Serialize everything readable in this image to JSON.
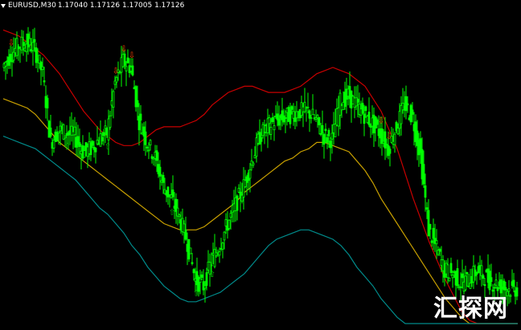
{
  "header": {
    "symbol_tf": "EURUSD,M30",
    "ohlc": "1.17040 1.17126 1.17005 1.17126"
  },
  "watermark": "汇探网",
  "colors": {
    "background": "#000000",
    "candle": "#00ff00",
    "band_upper": "#c80000",
    "band_mid": "#c8a000",
    "band_lower": "#008b8b",
    "arrow_down": "#ff4000",
    "arrow_up": "#00cc00"
  },
  "icons": {
    "dropdown": "triangle-down-icon",
    "sell_signal": "down-arrow-icon",
    "buy_signal": "up-arrow-icon"
  },
  "chart_data": {
    "type": "candlestick",
    "title": "EURUSD,M30",
    "xlabel": "",
    "ylabel": "",
    "grid": false,
    "ylim": [
      0,
      100
    ],
    "x": [
      0,
      1,
      2,
      3,
      4,
      5,
      6,
      7,
      8,
      9,
      10,
      11,
      12,
      13,
      14,
      15,
      16,
      17,
      18,
      19,
      20,
      21,
      22,
      23,
      24,
      25,
      26,
      27,
      28,
      29,
      30,
      31,
      32,
      33,
      34,
      35,
      36,
      37,
      38,
      39,
      40,
      41,
      42,
      43,
      44,
      45,
      46,
      47,
      48,
      49,
      50,
      51,
      52,
      53,
      54,
      55,
      56,
      57,
      58,
      59,
      60,
      61,
      62,
      63,
      64
    ],
    "close": [
      82,
      86,
      89,
      90,
      88,
      80,
      58,
      62,
      61,
      60,
      55,
      56,
      59,
      61,
      77,
      84,
      82,
      65,
      58,
      53,
      44,
      40,
      34,
      26,
      14,
      12,
      20,
      25,
      32,
      38,
      44,
      52,
      60,
      63,
      65,
      66,
      67,
      68,
      68,
      65,
      60,
      59,
      71,
      73,
      70,
      67,
      64,
      61,
      56,
      63,
      70,
      66,
      54,
      30,
      24,
      17,
      16,
      13,
      14,
      17,
      15,
      13,
      12,
      11,
      11
    ],
    "series": [
      {
        "values": [
          94,
          93,
          92,
          90,
          88,
          86,
          83,
          80,
          76,
          72,
          68,
          65,
          62,
          60,
          58,
          57,
          57,
          58,
          60,
          62,
          63,
          63,
          63,
          64,
          65,
          67,
          70,
          72,
          74,
          75,
          76,
          76,
          75,
          74,
          74,
          74,
          75,
          76,
          78,
          80,
          81,
          82,
          81,
          80,
          78,
          76,
          72,
          68,
          62,
          56,
          48,
          40,
          33,
          26,
          20,
          14,
          9,
          4,
          1,
          0,
          0,
          0,
          0,
          0,
          0
        ]
      },
      {
        "values": [
          72,
          71,
          70,
          69,
          67,
          64,
          61,
          58,
          56,
          54,
          52,
          50,
          48,
          46,
          44,
          42,
          40,
          38,
          36,
          34,
          32,
          31,
          30,
          30,
          30,
          31,
          33,
          35,
          37,
          39,
          42,
          44,
          46,
          48,
          50,
          52,
          53,
          55,
          56,
          58,
          58,
          57,
          56,
          55,
          52,
          49,
          45,
          40,
          36,
          32,
          28,
          24,
          20,
          16,
          12,
          8,
          5,
          2,
          0,
          0,
          0,
          0,
          0,
          0,
          0
        ]
      },
      {
        "values": [
          60,
          59,
          58,
          57,
          56,
          54,
          52,
          50,
          48,
          46,
          43,
          40,
          37,
          35,
          32,
          29,
          25,
          22,
          18,
          15,
          12,
          10,
          8,
          7,
          7,
          8,
          9,
          10,
          12,
          14,
          16,
          19,
          22,
          25,
          27,
          28,
          29,
          30,
          30,
          29,
          28,
          27,
          25,
          22,
          18,
          15,
          12,
          8,
          5,
          2,
          0,
          0,
          0,
          0,
          0,
          0,
          0,
          0,
          0,
          0,
          0,
          0,
          0,
          0,
          0
        ]
      }
    ],
    "signals": [
      {
        "type": "sell",
        "at": 1
      },
      {
        "type": "buy",
        "at": 8
      },
      {
        "type": "buy",
        "at": 13
      },
      {
        "type": "sell",
        "at": 15
      },
      {
        "type": "sell",
        "at": 16
      },
      {
        "type": "sell",
        "at": 14
      },
      {
        "type": "buy",
        "at": 21
      },
      {
        "type": "buy",
        "at": 24
      },
      {
        "type": "buy",
        "at": 26
      },
      {
        "type": "sell",
        "at": 48
      },
      {
        "type": "sell",
        "at": 47
      }
    ]
  }
}
